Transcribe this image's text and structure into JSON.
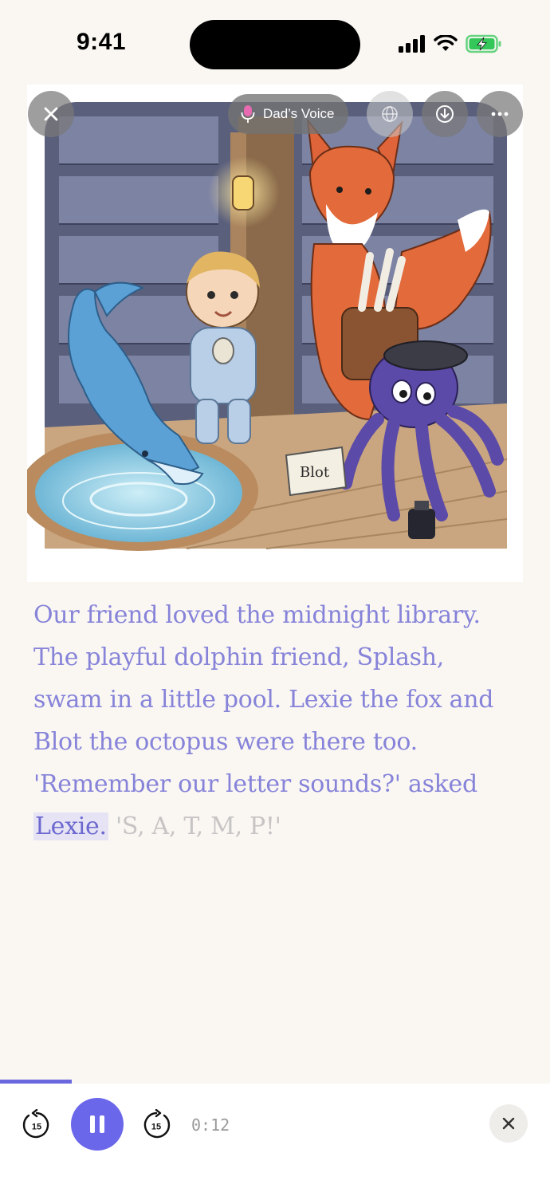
{
  "status_bar": {
    "time": "9:41"
  },
  "overlay": {
    "close_icon": "close-icon",
    "voice_chip": {
      "icon": "microphone-icon",
      "label": "Dad’s Voice"
    },
    "language_icon": "globe-icon",
    "download_icon": "download-icon",
    "more_icon": "more-icon"
  },
  "illustration": {
    "sign_text": "Blot"
  },
  "story": {
    "read_text": "Our friend loved the midnight library. The playful dolphin friend, Splash, swam in a little pool. Lexie the fox and Blot the octopus were there too. 'Remember our letter sounds?' asked",
    "current_word": "Lexie.",
    "unread_text": "'S, A, T, M, P!'"
  },
  "player": {
    "progress": 0.13,
    "skip_back_seconds": "15",
    "skip_forward_seconds": "15",
    "elapsed": "0:12",
    "state": "playing"
  },
  "colors": {
    "accent": "#6b67ea",
    "story_text": "#8683d9",
    "unread_text": "#c6c4c4",
    "background": "#faf7f3"
  }
}
